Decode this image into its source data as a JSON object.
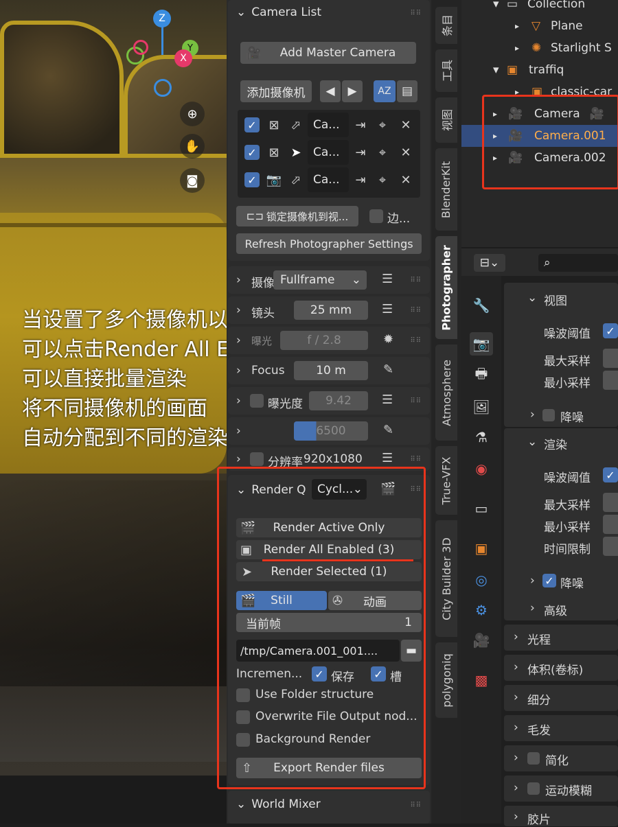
{
  "overlay_text": "当设置了多个摄像机以后\n可以点击Render All Enabled\n可以直接批量渲染\n将不同摄像机的画面\n自动分配到不同的渲染槽中",
  "gizmo": {
    "z": "Z",
    "y": "Y",
    "x": "X"
  },
  "camera_list": {
    "title": "Camera List",
    "add_master": "Add Master Camera",
    "add_camera": "添加摄像机",
    "cameras": [
      {
        "name": "Ca..."
      },
      {
        "name": "Ca..."
      },
      {
        "name": "Ca..."
      }
    ],
    "lock_camera": "锁定摄像机到视...",
    "border": "边...",
    "refresh": "Refresh Photographer Settings"
  },
  "photographer": {
    "sensor_label": "摄像",
    "sensor_value": "Fullframe",
    "lens_label": "镜头",
    "lens_value": "25 mm",
    "exposure_label": "曝光",
    "exposure_value": "f / 2.8",
    "focus_label": "Focus",
    "focus_value": "10 m",
    "exposure2_label": "曝光度",
    "exposure2_value": "9.42",
    "wb_value": "6500",
    "resolution_label": "分辨率",
    "resolution_value": "920x1080"
  },
  "render_queue": {
    "title": "Render Q",
    "engine": "Cycl...",
    "render_active": "Render Active Only",
    "render_all": "Render All Enabled (3)",
    "render_selected": "Render Selected (1)",
    "still": "Still",
    "animation": "动画",
    "current_frame_label": "当前帧",
    "current_frame_value": "1",
    "output_path": "/tmp/Camera.001_001....",
    "increment": "Incremen...",
    "save": "保存",
    "slot": "槽",
    "use_folder": "Use Folder structure",
    "overwrite": "Overwrite File Output nod...",
    "background_render": "Background Render",
    "export": "Export Render files"
  },
  "world_mixer": {
    "title": "World Mixer"
  },
  "tabs": [
    "条目",
    "工具",
    "视图",
    "BlenderKit",
    "Photographer",
    "Atmosphere",
    "True-VFX",
    "City Builder 3D",
    "polygoniq"
  ],
  "outliner": [
    {
      "name": "Collection"
    },
    {
      "name": "Plane"
    },
    {
      "name": "Starlight S"
    },
    {
      "name": "traffiq"
    },
    {
      "name": "classic-car"
    },
    {
      "name": "Camera"
    },
    {
      "name": "Camera.001"
    },
    {
      "name": "Camera.002"
    }
  ],
  "properties": {
    "viewport_section": "视图",
    "noise_threshold": "噪波阈值",
    "max_samples": "最大采样",
    "min_samples": "最小采样",
    "denoise": "降噪",
    "render_section": "渲染",
    "time_limit": "时间限制",
    "advanced": "高级",
    "light_paths": "光程",
    "volumes": "体积(卷标)",
    "subdivision": "细分",
    "hair": "毛发",
    "simplify": "简化",
    "motion_blur": "运动模糊",
    "film": "胶片"
  },
  "colors": {
    "accent": "#4772b3",
    "highlight_red": "#e8341c",
    "selected_row": "#334d80"
  }
}
